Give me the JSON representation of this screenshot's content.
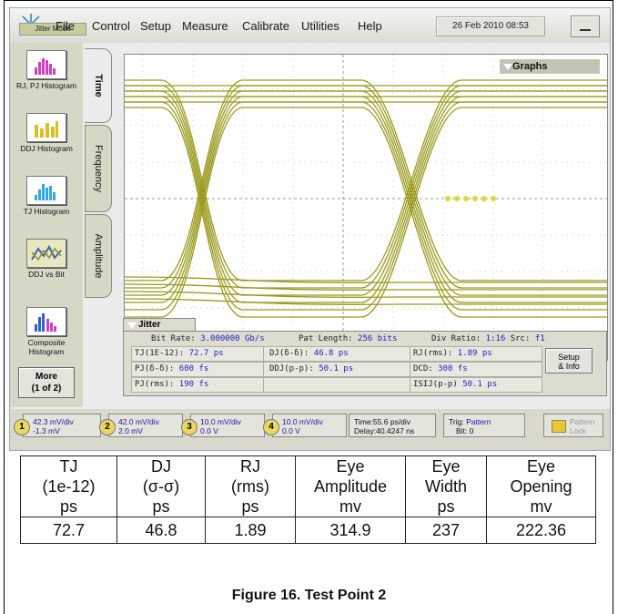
{
  "menubar": {
    "items": [
      "File",
      "Control",
      "Setup",
      "Measure",
      "Calibrate",
      "Utilities",
      "Help"
    ],
    "datetime": "26 Feb 2010  08:53",
    "mode_label": "Jitter Mode"
  },
  "sidebar": {
    "buttons": [
      "RJ, PJ Histogram",
      "DDJ Histogram",
      "TJ Histogram",
      "DDJ vs Bit",
      "Composite Histogram"
    ],
    "more_line1": "More",
    "more_line2": "(1 of 2)"
  },
  "tabs": [
    "Time",
    "Frequency",
    "Amplitude"
  ],
  "graphs_button": "Graphs",
  "jitter": {
    "header": "Jitter",
    "bit_rate_label": "Bit Rate:",
    "bit_rate_value": "3.000000 Gb/s",
    "pat_length_label": "Pat Length:",
    "pat_length_value": "256 bits",
    "div_ratio_label": "Div Ratio:",
    "div_ratio_value": "1:16",
    "src_label": "Src:",
    "src_value": "f1",
    "rows": [
      [
        {
          "label": "TJ(1E-12):",
          "value": "72.7 ps"
        },
        {
          "label": "DJ(δ-δ):",
          "value": "46.8 ps"
        },
        {
          "label": "RJ(rms):",
          "value": "1.89 ps"
        }
      ],
      [
        {
          "label": "PJ(δ-δ):",
          "value": "600 fs"
        },
        {
          "label": "DDJ(p-p):",
          "value": "50.1 ps"
        },
        {
          "label": "DCD:",
          "value": "300 fs"
        }
      ],
      [
        {
          "label": "PJ(rms):",
          "value": "190 fs"
        },
        {
          "label": "",
          "value": ""
        },
        {
          "label": "ISIJ(p-p)",
          "value": "50.1 ps"
        }
      ]
    ],
    "setup_line1": "Setup",
    "setup_line2": "& Info"
  },
  "channels": [
    {
      "num": "1",
      "scale": "42.3 mV/div",
      "offset": "-1.3 mV"
    },
    {
      "num": "2",
      "scale": "42.0 mV/div",
      "offset": "2.0 mV"
    },
    {
      "num": "3",
      "scale": "10.0 mV/div",
      "offset": "0.0 V"
    },
    {
      "num": "4",
      "scale": "10.0 mV/div",
      "offset": "0.0 V"
    }
  ],
  "timebase": {
    "line1": "Time:55.6 ps/div",
    "line2": "Delay:40.4247 ns"
  },
  "trigger": {
    "label1": "Trig:",
    "value1": "Pattern",
    "label2": "Bit:",
    "value2": "0"
  },
  "pattern_lock": {
    "line1": "Pattern",
    "line2": "Lock"
  },
  "results_table": {
    "headers": [
      [
        "TJ",
        "(1e-12)",
        "ps"
      ],
      [
        "DJ",
        "(σ-σ)",
        "ps"
      ],
      [
        "RJ",
        "(rms)",
        "ps"
      ],
      [
        "Eye",
        "Amplitude",
        "mv"
      ],
      [
        "Eye",
        "Width",
        "ps"
      ],
      [
        "Eye",
        "Opening",
        "mv"
      ]
    ],
    "values": [
      "72.7",
      "46.8",
      "1.89",
      "314.9",
      "237",
      "222.36"
    ]
  },
  "caption": "Figure 16. Test Point 2",
  "colors": {
    "trace": "#9a9a1e",
    "accent_blue": "#1f1fbf"
  }
}
